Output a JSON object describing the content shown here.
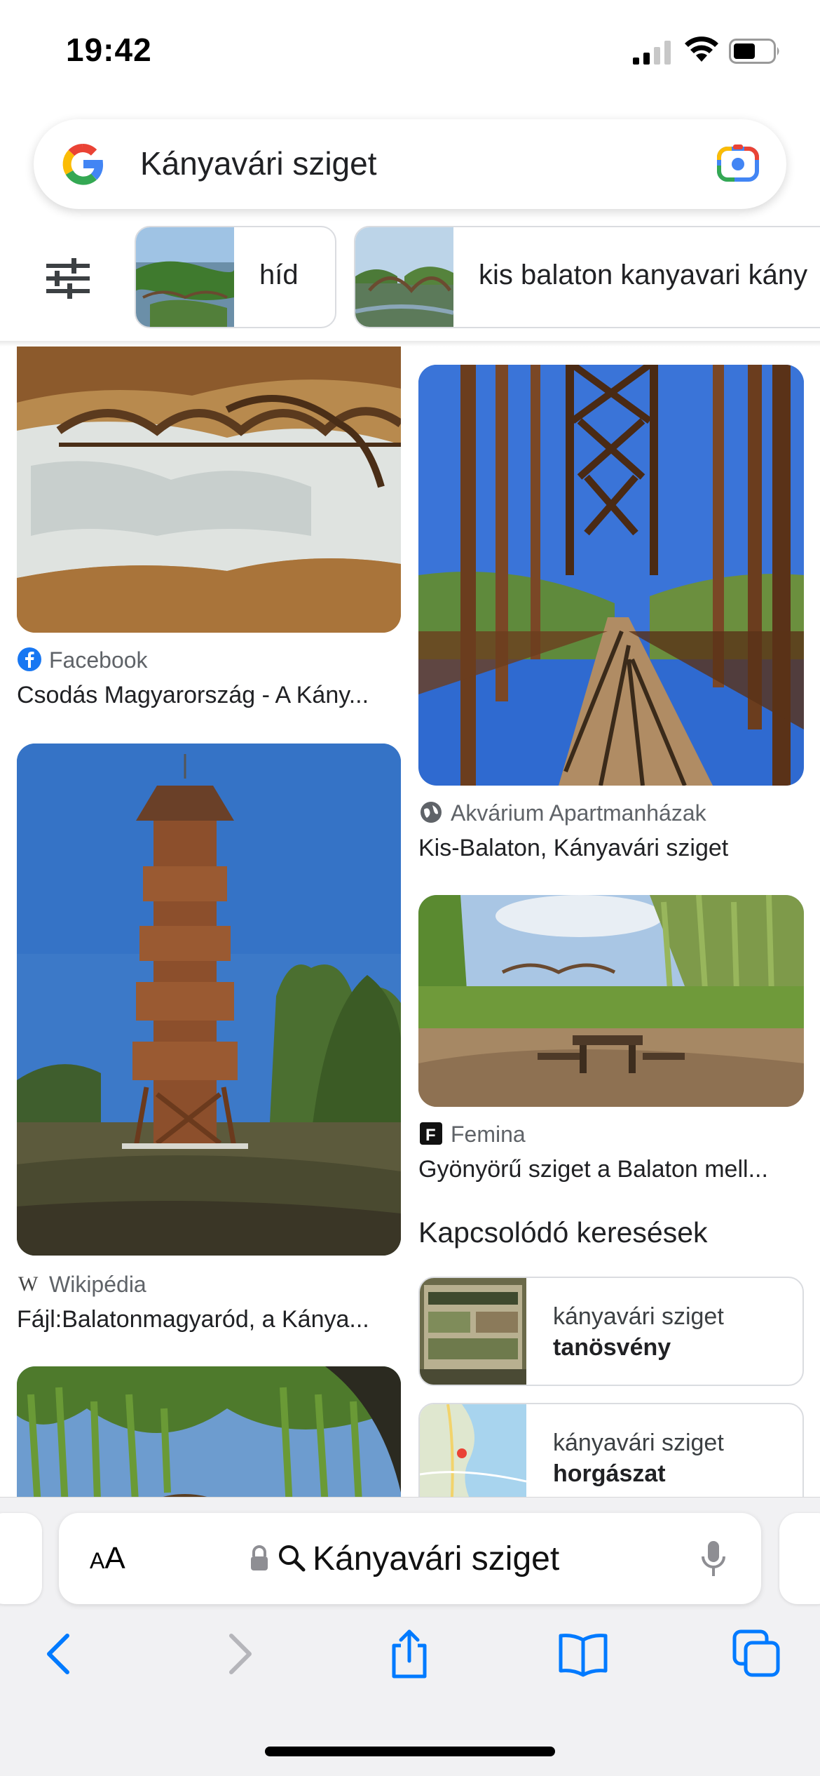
{
  "status_bar": {
    "time": "19:42"
  },
  "search": {
    "query": "Kányavári sziget"
  },
  "chips": [
    {
      "label": "híd"
    },
    {
      "label": "kis balaton kanyavari kány"
    }
  ],
  "results": {
    "left": [
      {
        "source": "Facebook",
        "title": "Csodás Magyarország - A Kány..."
      },
      {
        "source": "Wikipédia",
        "title": "Fájl:Balatonmagyaród, a Kánya..."
      }
    ],
    "right": [
      {
        "source": "Akvárium Apartmanházak",
        "title": "Kis-Balaton, Kányavári sziget"
      },
      {
        "source": "Femina",
        "title": "Gyönyörű sziget a Balaton mell..."
      }
    ]
  },
  "related": {
    "title": "Kapcsolódó keresések",
    "items": [
      {
        "line1": "kányavári sziget",
        "line2": "tanösvény"
      },
      {
        "line1": "kányavári sziget",
        "line2": "horgászat"
      }
    ]
  },
  "browser": {
    "text_size_button": "AA",
    "address": "Kányavári sziget"
  },
  "colors": {
    "accent_blue": "#1a73e8",
    "ios_blue": "#007aff",
    "facebook_blue": "#1877f2"
  }
}
